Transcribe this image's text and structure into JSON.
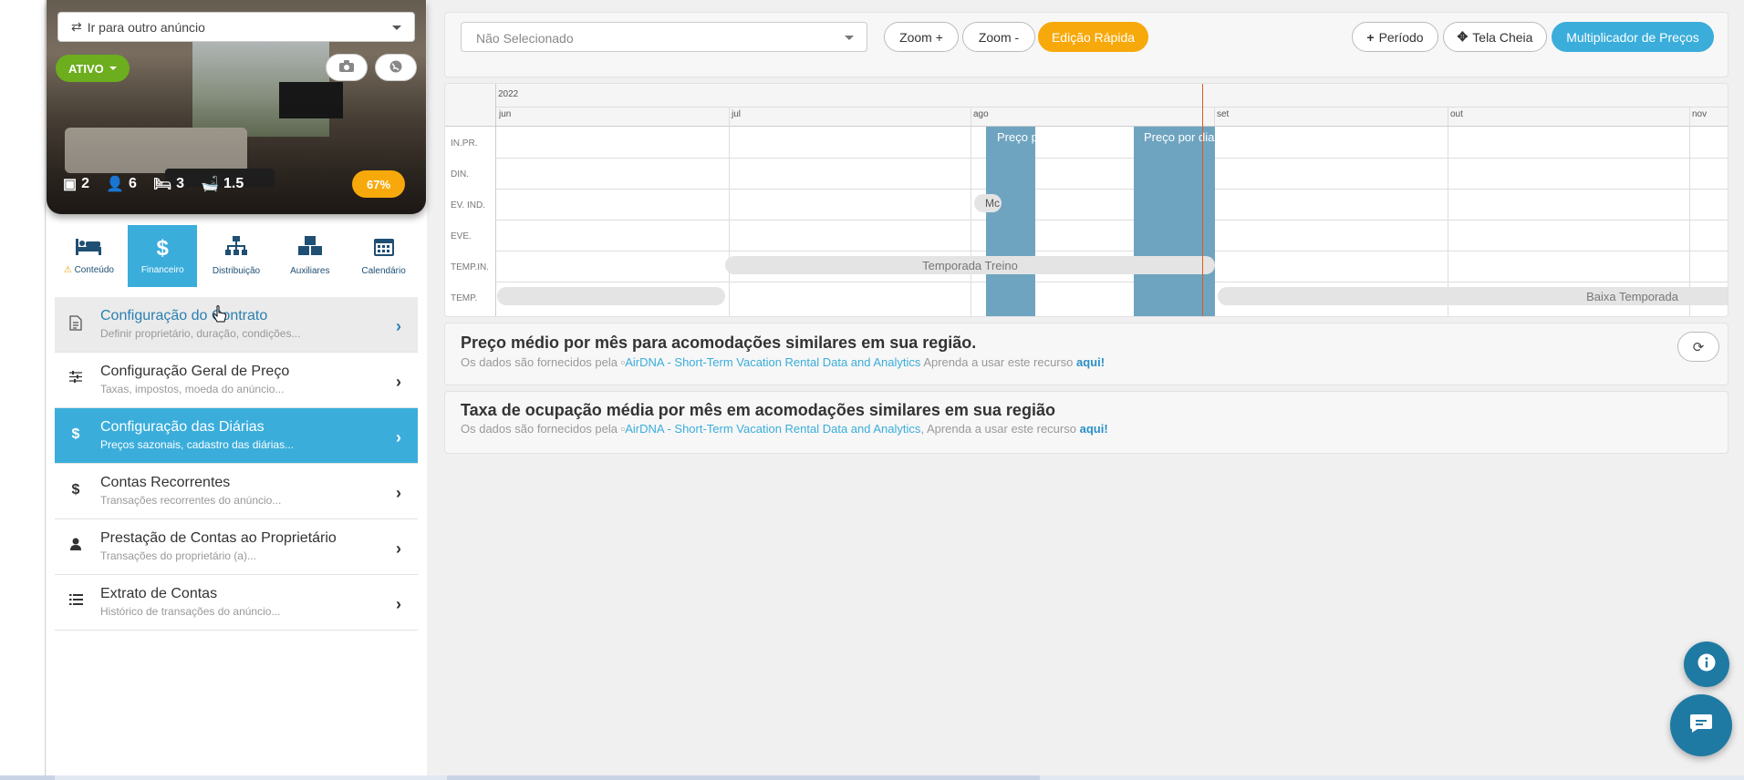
{
  "sidebar": {
    "goto_label": "Ir para outro anúncio",
    "status_label": "ATIVO",
    "stats": [
      {
        "icon": "cube-icon",
        "value": "2"
      },
      {
        "icon": "user-icon",
        "value": "6"
      },
      {
        "icon": "bed-icon",
        "value": "3"
      },
      {
        "icon": "bath-icon",
        "value": "1.5"
      }
    ],
    "completion": "67%",
    "tabs": [
      {
        "label": "Conteúdo",
        "icon": "bed-icon"
      },
      {
        "label": "Financeiro",
        "icon": "dollar-icon"
      },
      {
        "label": "Distribuição",
        "icon": "sitemap-icon"
      },
      {
        "label": "Auxiliares",
        "icon": "cubes-icon"
      },
      {
        "label": "Calendário",
        "icon": "calendar-icon"
      }
    ],
    "menu": [
      {
        "title": "Configuração do Contrato",
        "subtitle": "Definir proprietário, duração, condições...",
        "icon": "document-icon"
      },
      {
        "title": "Configuração Geral de Preço",
        "subtitle": "Taxas, impostos, moeda do anúncio...",
        "icon": "sliders-icon"
      },
      {
        "title": "Configuração das Diárias",
        "subtitle": "Preços sazonais, cadastro das diárias...",
        "icon": "dollar-icon"
      },
      {
        "title": "Contas Recorrentes",
        "subtitle": "Transações recorrentes do anúncio...",
        "icon": "dollar-icon"
      },
      {
        "title": "Prestação de Contas ao Proprietário",
        "subtitle": "Transações do proprietário (a)...",
        "icon": "user-icon"
      },
      {
        "title": "Extrato de Contas",
        "subtitle": "Histórico de transações do anúncio...",
        "icon": "list-icon"
      }
    ]
  },
  "toolbar": {
    "select_placeholder": "Não Selecionado",
    "zoom_in": "Zoom +",
    "zoom_out": "Zoom -",
    "quick_edit": "Edição Rápida",
    "period": "Período",
    "fullscreen": "Tela Cheia",
    "multiplier": "Multiplicador de Preços"
  },
  "timeline": {
    "year": "2022",
    "months": [
      "jun",
      "jul",
      "ago",
      "set",
      "out",
      "nov"
    ],
    "rows": [
      "IN.PR.",
      "DIN.",
      "EV. IND.",
      "EVE.",
      "TEMP.IN.",
      "TEMP."
    ],
    "band_labels": [
      "Preço p",
      "Preço por dia"
    ],
    "event_label": "Mc",
    "season_training": "Temporada Treino",
    "season_low": "Baixa Temporada"
  },
  "card_price": {
    "title": "Preço médio por mês para acomodações similares em sua região.",
    "provided_by": "Os dados são fornecidos pela",
    "source": "AirDNA - Short-Term Vacation Rental Data and Analytics",
    "learn": "Aprenda a usar este recurso",
    "here": "aqui!"
  },
  "card_occupancy": {
    "title": "Taxa de ocupação média por mês em acomodações similares em sua região",
    "provided_by": "Os dados são fornecidos pela",
    "source": "AirDNA - Short-Term Vacation Rental Data and Analytics",
    "learn": "Aprenda a usar este recurso",
    "here": "aqui!"
  },
  "colors": {
    "accent_blue": "#3aaddb",
    "accent_orange": "#f7a90b",
    "status_green": "#6cae1e",
    "band_blue": "#6fa4c0",
    "today_line": "#e05a1a"
  }
}
